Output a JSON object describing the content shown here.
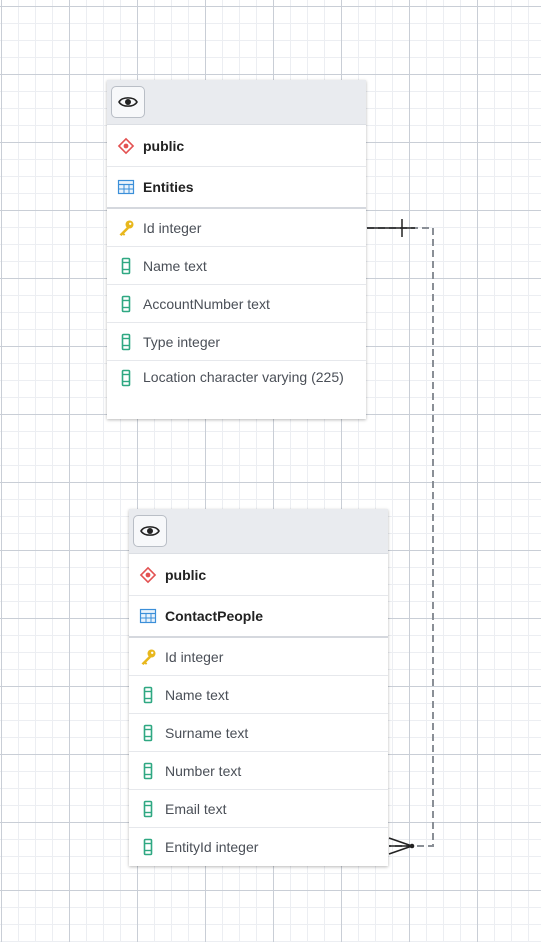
{
  "tables": [
    {
      "schema": "public",
      "name": "Entities",
      "columns": [
        {
          "label": "Id integer",
          "key": true
        },
        {
          "label": "Name text",
          "key": false
        },
        {
          "label": "AccountNumber text",
          "key": false
        },
        {
          "label": "Type integer",
          "key": false
        },
        {
          "label": "Location character varying (225)",
          "key": false
        }
      ]
    },
    {
      "schema": "public",
      "name": "ContactPeople",
      "columns": [
        {
          "label": "Id integer",
          "key": true
        },
        {
          "label": "Name text",
          "key": false
        },
        {
          "label": "Surname text",
          "key": false
        },
        {
          "label": "Number text",
          "key": false
        },
        {
          "label": "Email text",
          "key": false
        },
        {
          "label": "EntityId integer",
          "key": false
        }
      ]
    }
  ],
  "relationship": {
    "from": "Entities.Id",
    "to": "ContactPeople.EntityId",
    "from_cardinality": "one",
    "to_cardinality": "many"
  },
  "colors": {
    "key_icon": "#e8b71c",
    "column_icon": "#2fa882",
    "table_icon": "#3b8fd9",
    "schema_icon": "#e35252",
    "relation_line": "#8a8f96"
  }
}
